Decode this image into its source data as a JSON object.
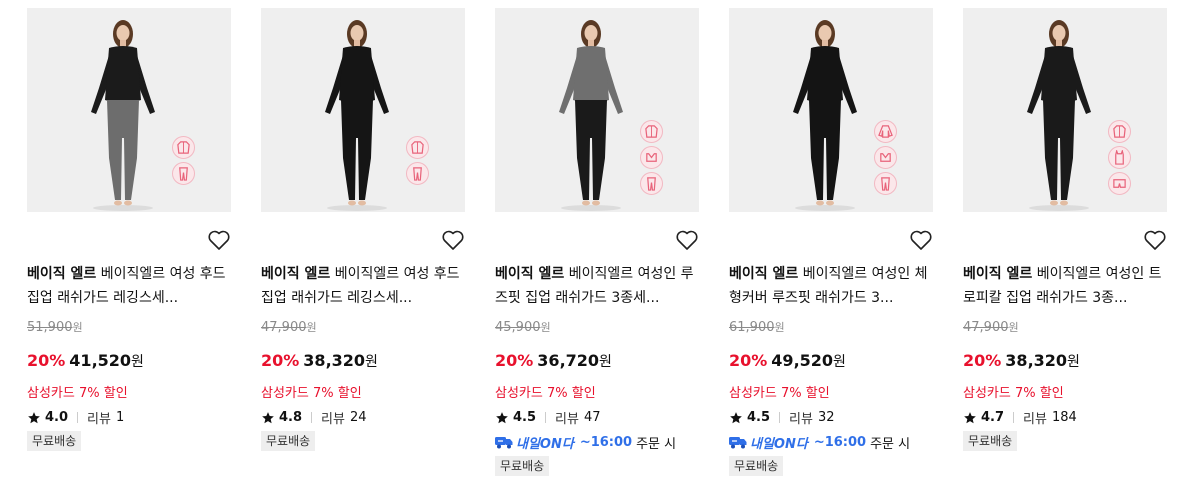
{
  "products": [
    {
      "brand": "베이직 엘르",
      "name": "베이직엘르 여성 후드집업 래쉬가드 레깅스세...",
      "original_price": "51,900",
      "discount_rate": "20%",
      "sale_price": "41,520",
      "currency": "원",
      "card_discount": "삼성카드 7% 할인",
      "rating": "4.0",
      "review_label": "리뷰",
      "review_count": "1",
      "delivery": null,
      "badge": "무료배송",
      "top_color": "#1b1b1b",
      "bottom_color": "#6d6d6d",
      "style_icons": [
        "jacket-icon",
        "leggings-icon"
      ]
    },
    {
      "brand": "베이직 엘르",
      "name": "베이직엘르 여성 후드집업 래쉬가드 레깅스세...",
      "original_price": "47,900",
      "discount_rate": "20%",
      "sale_price": "38,320",
      "currency": "원",
      "card_discount": "삼성카드 7% 할인",
      "rating": "4.8",
      "review_label": "리뷰",
      "review_count": "24",
      "delivery": null,
      "badge": "무료배송",
      "top_color": "#151515",
      "bottom_color": "#151515",
      "style_icons": [
        "jacket-icon",
        "leggings-icon"
      ]
    },
    {
      "brand": "베이직 엘르",
      "name": "베이직엘르 여성인 루즈핏 집업 래쉬가드 3종세...",
      "original_price": "45,900",
      "discount_rate": "20%",
      "sale_price": "36,720",
      "currency": "원",
      "card_discount": "삼성카드 7% 할인",
      "rating": "4.5",
      "review_label": "리뷰",
      "review_count": "47",
      "delivery": {
        "brand": "내일ON다",
        "time": "~16:00",
        "suffix": "주문 시"
      },
      "badge": "무료배송",
      "top_color": "#6f6f6f",
      "bottom_color": "#1a1a1a",
      "style_icons": [
        "jacket-icon",
        "bra-top-icon",
        "leggings-icon"
      ]
    },
    {
      "brand": "베이직 엘르",
      "name": "베이직엘르 여성인 체형커버 루즈핏 래쉬가드 3...",
      "original_price": "61,900",
      "discount_rate": "20%",
      "sale_price": "49,520",
      "currency": "원",
      "card_discount": "삼성카드 7% 할인",
      "rating": "4.5",
      "review_label": "리뷰",
      "review_count": "32",
      "delivery": {
        "brand": "내일ON다",
        "time": "~16:00",
        "suffix": "주문 시"
      },
      "badge": "무료배송",
      "top_color": "#141414",
      "bottom_color": "#141414",
      "style_icons": [
        "long-sleeve-icon",
        "bra-top-icon",
        "leggings-icon"
      ]
    },
    {
      "brand": "베이직 엘르",
      "name": "베이직엘르 여성인 트로피칼 집업 래쉬가드 3종...",
      "original_price": "47,900",
      "discount_rate": "20%",
      "sale_price": "38,320",
      "currency": "원",
      "card_discount": "삼성카드 7% 할인",
      "rating": "4.7",
      "review_label": "리뷰",
      "review_count": "184",
      "delivery": null,
      "badge": "무료배송",
      "top_color": "#1a1a1a",
      "bottom_color": "#1a1a1a",
      "style_icons": [
        "jacket-icon",
        "tank-top-icon",
        "shorts-icon"
      ]
    }
  ],
  "colors": {
    "sale_red": "#e8112d",
    "delivery_blue": "#2f6fe8",
    "pictogram_pink": "#f2b8c2"
  }
}
